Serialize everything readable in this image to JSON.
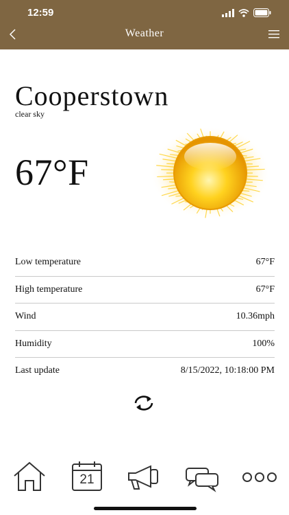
{
  "status": {
    "time": "12:59"
  },
  "nav": {
    "title": "Weather"
  },
  "weather": {
    "city": "Cooperstown",
    "description": "clear sky",
    "temperature": "67°F"
  },
  "details": [
    {
      "label": "Low temperature",
      "value": "67°F"
    },
    {
      "label": "High temperature",
      "value": "67°F"
    },
    {
      "label": "Wind",
      "value": "10.36mph"
    },
    {
      "label": "Humidity",
      "value": "100%"
    },
    {
      "label": "Last update",
      "value": "8/15/2022, 10:18:00 PM"
    }
  ],
  "tabbar": {
    "calendar_day": "21",
    "icons": [
      "home-icon",
      "calendar-icon",
      "megaphone-icon",
      "chat-icon",
      "more-icon"
    ]
  },
  "colors": {
    "header": "#7f6642",
    "sun": "#f2b800",
    "divider": "#c9c9c9"
  }
}
